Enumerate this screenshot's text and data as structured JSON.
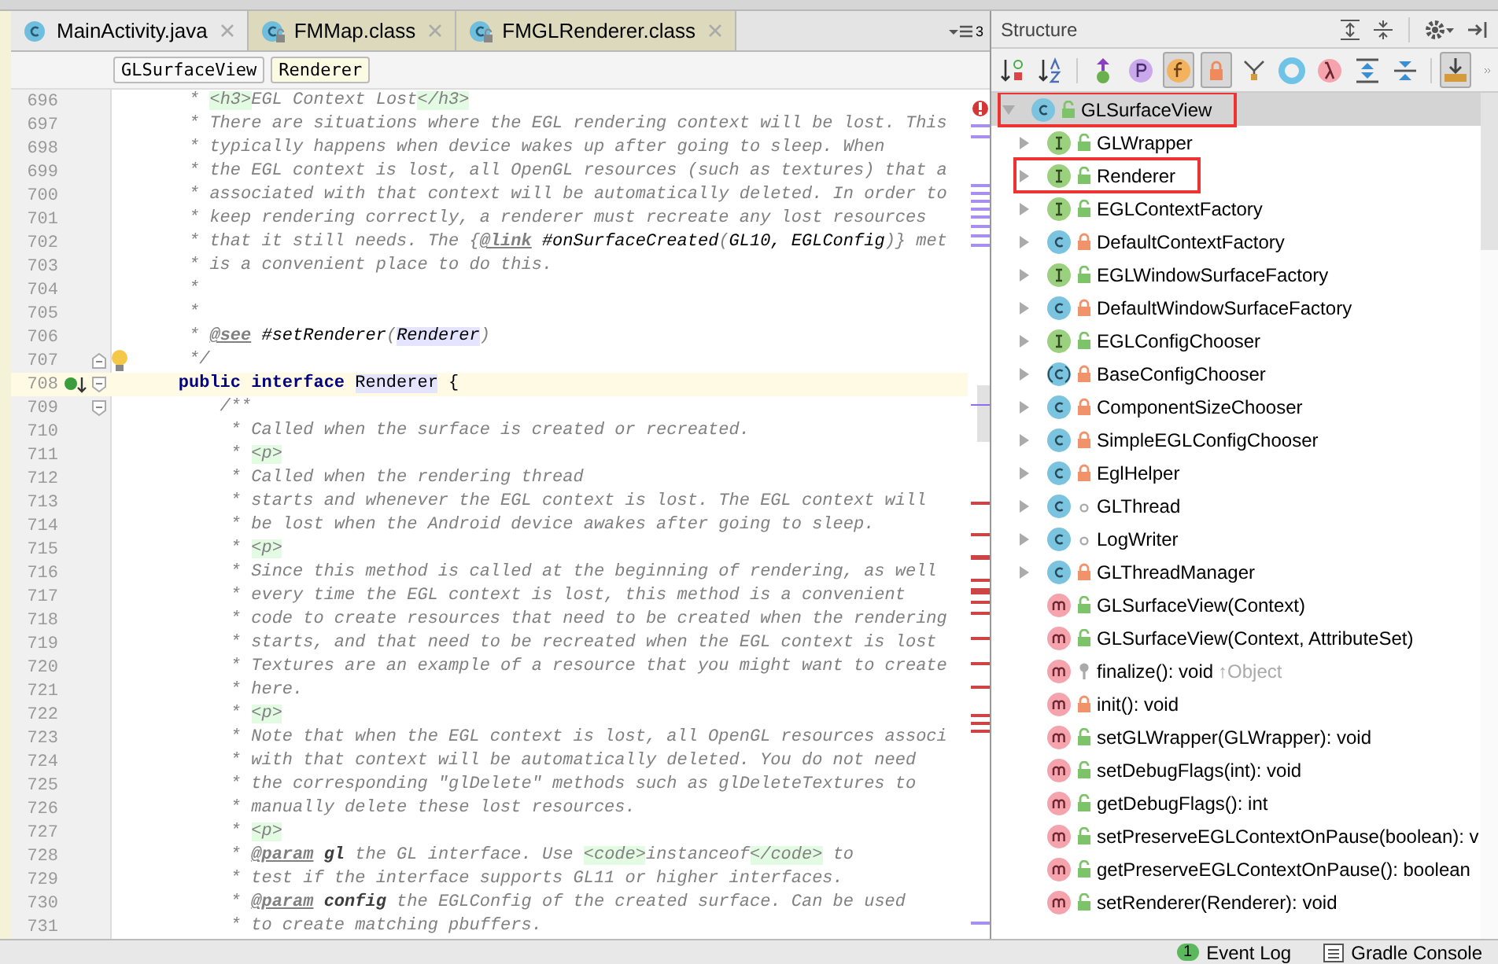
{
  "editor": {
    "tabs": [
      {
        "label": "MainActivity.java",
        "kind": "source"
      },
      {
        "label": "FMMap.class",
        "kind": "library"
      },
      {
        "label": "FMGLRenderer.class",
        "kind": "library"
      }
    ],
    "hidden_tabs_count": "3",
    "breadcrumbs": [
      {
        "label": "GLSurfaceView",
        "selected": false
      },
      {
        "label": "Renderer",
        "selected": true
      }
    ],
    "lines": [
      {
        "num": "696",
        "parts": [
          {
            "kind": "comment",
            "text": "     * "
          },
          {
            "kind": "tag",
            "text": "<h3>"
          },
          {
            "kind": "comment",
            "text": "EGL Context Lost"
          },
          {
            "kind": "tag",
            "text": "</h3>"
          }
        ]
      },
      {
        "num": "697",
        "parts": [
          {
            "kind": "comment",
            "text": "     * There are situations where the EGL rendering context will be lost. This"
          }
        ]
      },
      {
        "num": "698",
        "parts": [
          {
            "kind": "comment",
            "text": "     * typically happens when device wakes up after going to sleep. When"
          }
        ]
      },
      {
        "num": "699",
        "parts": [
          {
            "kind": "comment",
            "text": "     * the EGL context is lost, all OpenGL resources (such as textures) that a"
          }
        ]
      },
      {
        "num": "700",
        "parts": [
          {
            "kind": "comment",
            "text": "     * associated with that context will be automatically deleted. In order to"
          }
        ]
      },
      {
        "num": "701",
        "parts": [
          {
            "kind": "comment",
            "text": "     * keep rendering correctly, a renderer must recreate any lost resources"
          }
        ]
      },
      {
        "num": "702",
        "parts": [
          {
            "kind": "comment",
            "text": "     * that it still needs. The {"
          },
          {
            "kind": "doctag",
            "text": "@link"
          },
          {
            "kind": "ref",
            "text": " #onSurfaceCreated"
          },
          {
            "kind": "comment",
            "text": "("
          },
          {
            "kind": "ref",
            "text": "GL10, EGLConfig"
          },
          {
            "kind": "comment",
            "text": ")} met"
          }
        ]
      },
      {
        "num": "703",
        "parts": [
          {
            "kind": "comment",
            "text": "     * is a convenient place to do this."
          }
        ]
      },
      {
        "num": "704",
        "parts": [
          {
            "kind": "comment",
            "text": "     *"
          }
        ]
      },
      {
        "num": "705",
        "parts": [
          {
            "kind": "comment",
            "text": "     *"
          }
        ]
      },
      {
        "num": "706",
        "parts": [
          {
            "kind": "comment",
            "text": "     * "
          },
          {
            "kind": "doctag",
            "text": "@see"
          },
          {
            "kind": "ref",
            "text": " #setRenderer"
          },
          {
            "kind": "comment",
            "text": "("
          },
          {
            "kind": "usage",
            "text": "Renderer"
          },
          {
            "kind": "comment",
            "text": ")"
          }
        ]
      },
      {
        "num": "707",
        "fold_end": true,
        "bulb": true,
        "parts": [
          {
            "kind": "comment",
            "text": "     */"
          }
        ]
      },
      {
        "num": "708",
        "fold_start": true,
        "implemented": true,
        "current": true,
        "parts": [
          {
            "kind": "keyword",
            "text": "    public interface "
          },
          {
            "kind": "usage",
            "text": "Renderer"
          },
          {
            "kind": "code",
            "text": " {"
          }
        ]
      },
      {
        "num": "709",
        "fold_start": true,
        "parts": [
          {
            "kind": "comment",
            "text": "        /**"
          }
        ]
      },
      {
        "num": "710",
        "parts": [
          {
            "kind": "comment",
            "text": "         * Called when the surface is created or recreated."
          }
        ]
      },
      {
        "num": "711",
        "parts": [
          {
            "kind": "comment",
            "text": "         * "
          },
          {
            "kind": "tag",
            "text": "<p>"
          }
        ]
      },
      {
        "num": "712",
        "parts": [
          {
            "kind": "comment",
            "text": "         * Called when the rendering thread"
          }
        ]
      },
      {
        "num": "713",
        "parts": [
          {
            "kind": "comment",
            "text": "         * starts and whenever the EGL context is lost. The EGL context will"
          }
        ]
      },
      {
        "num": "714",
        "parts": [
          {
            "kind": "comment",
            "text": "         * be lost when the Android device awakes after going to sleep."
          }
        ]
      },
      {
        "num": "715",
        "parts": [
          {
            "kind": "comment",
            "text": "         * "
          },
          {
            "kind": "tag",
            "text": "<p>"
          }
        ]
      },
      {
        "num": "716",
        "parts": [
          {
            "kind": "comment",
            "text": "         * Since this method is called at the beginning of rendering, as well"
          }
        ]
      },
      {
        "num": "717",
        "parts": [
          {
            "kind": "comment",
            "text": "         * every time the EGL context is lost, this method is a convenient"
          }
        ]
      },
      {
        "num": "718",
        "parts": [
          {
            "kind": "comment",
            "text": "         * code to create resources that need to be created when the rendering"
          }
        ]
      },
      {
        "num": "719",
        "parts": [
          {
            "kind": "comment",
            "text": "         * starts, and that need to be recreated when the EGL context is lost"
          }
        ]
      },
      {
        "num": "720",
        "parts": [
          {
            "kind": "comment",
            "text": "         * Textures are an example of a resource that you might want to create"
          }
        ]
      },
      {
        "num": "721",
        "parts": [
          {
            "kind": "comment",
            "text": "         * here."
          }
        ]
      },
      {
        "num": "722",
        "parts": [
          {
            "kind": "comment",
            "text": "         * "
          },
          {
            "kind": "tag",
            "text": "<p>"
          }
        ]
      },
      {
        "num": "723",
        "parts": [
          {
            "kind": "comment",
            "text": "         * Note that when the EGL context is lost, all OpenGL resources associ"
          }
        ]
      },
      {
        "num": "724",
        "parts": [
          {
            "kind": "comment",
            "text": "         * with that context will be automatically deleted. You do not need"
          }
        ]
      },
      {
        "num": "725",
        "parts": [
          {
            "kind": "comment",
            "text": "         * the corresponding \"glDelete\" methods such as glDeleteTextures to"
          }
        ]
      },
      {
        "num": "726",
        "parts": [
          {
            "kind": "comment",
            "text": "         * manually delete these lost resources."
          }
        ]
      },
      {
        "num": "727",
        "parts": [
          {
            "kind": "comment",
            "text": "         * "
          },
          {
            "kind": "tag",
            "text": "<p>"
          }
        ]
      },
      {
        "num": "728",
        "parts": [
          {
            "kind": "comment",
            "text": "         * "
          },
          {
            "kind": "doctag",
            "text": "@param"
          },
          {
            "kind": "param",
            "text": " gl"
          },
          {
            "kind": "comment",
            "text": " the GL interface. Use "
          },
          {
            "kind": "tag",
            "text": "<code>"
          },
          {
            "kind": "comment",
            "text": "instanceof"
          },
          {
            "kind": "tag",
            "text": "</code>"
          },
          {
            "kind": "comment",
            "text": " to"
          }
        ]
      },
      {
        "num": "729",
        "parts": [
          {
            "kind": "comment",
            "text": "         * test if the interface supports GL11 or higher interfaces."
          }
        ]
      },
      {
        "num": "730",
        "parts": [
          {
            "kind": "comment",
            "text": "         * "
          },
          {
            "kind": "doctag",
            "text": "@param"
          },
          {
            "kind": "param",
            "text": " config"
          },
          {
            "kind": "comment",
            "text": " the EGLConfig of the created surface. Can be used"
          }
        ]
      },
      {
        "num": "731",
        "parts": [
          {
            "kind": "comment",
            "text": "         * to create matching pbuffers."
          }
        ]
      }
    ]
  },
  "structure": {
    "title": "Structure",
    "toolbar": [
      {
        "kind": "sort-visibility",
        "on": false
      },
      {
        "kind": "sort-alpha",
        "on": false
      },
      {
        "kind": "inherited",
        "on": false
      },
      {
        "kind": "properties",
        "on": false
      },
      {
        "kind": "fields",
        "on": true
      },
      {
        "kind": "non-public",
        "on": true
      },
      {
        "kind": "anonymous",
        "on": false
      },
      {
        "kind": "circle",
        "on": false
      },
      {
        "kind": "lambda",
        "on": false
      },
      {
        "kind": "expand",
        "on": false
      },
      {
        "kind": "collapse",
        "on": false
      },
      {
        "kind": "autoscroll",
        "on": true
      }
    ],
    "tree": {
      "name": "GLSurfaceView",
      "kind": "class",
      "private": false,
      "protected": false,
      "package": false,
      "expanded": true,
      "selected": true,
      "highlighted": true,
      "children": [
        {
          "name": "GLWrapper",
          "kind": "interface",
          "private": false,
          "protected": false,
          "package": false,
          "expandable": true,
          "highlighted": false
        },
        {
          "name": "Renderer",
          "kind": "interface",
          "private": false,
          "protected": false,
          "package": false,
          "expandable": true,
          "highlighted": true
        },
        {
          "name": "EGLContextFactory",
          "kind": "interface",
          "private": false,
          "protected": false,
          "package": false,
          "expandable": true,
          "highlighted": false
        },
        {
          "name": "DefaultContextFactory",
          "kind": "class",
          "private": true,
          "protected": false,
          "package": false,
          "expandable": true,
          "highlighted": false
        },
        {
          "name": "EGLWindowSurfaceFactory",
          "kind": "interface",
          "private": false,
          "protected": false,
          "package": false,
          "expandable": true,
          "highlighted": false
        },
        {
          "name": "DefaultWindowSurfaceFactory",
          "kind": "class",
          "private": true,
          "protected": false,
          "package": false,
          "expandable": true,
          "highlighted": false
        },
        {
          "name": "EGLConfigChooser",
          "kind": "interface",
          "private": false,
          "protected": false,
          "package": false,
          "expandable": true,
          "highlighted": false
        },
        {
          "name": "BaseConfigChooser",
          "kind": "abstract",
          "private": true,
          "protected": false,
          "package": false,
          "expandable": true,
          "highlighted": false
        },
        {
          "name": "ComponentSizeChooser",
          "kind": "class",
          "private": true,
          "protected": false,
          "package": false,
          "expandable": true,
          "highlighted": false
        },
        {
          "name": "SimpleEGLConfigChooser",
          "kind": "class",
          "private": true,
          "protected": false,
          "package": false,
          "expandable": true,
          "highlighted": false
        },
        {
          "name": "EglHelper",
          "kind": "class",
          "private": true,
          "protected": false,
          "package": false,
          "expandable": true,
          "highlighted": false
        },
        {
          "name": "GLThread",
          "kind": "class",
          "private": false,
          "protected": false,
          "package": true,
          "expandable": true,
          "highlighted": false
        },
        {
          "name": "LogWriter",
          "kind": "class",
          "private": false,
          "protected": false,
          "package": true,
          "expandable": true,
          "highlighted": false
        },
        {
          "name": "GLThreadManager",
          "kind": "class",
          "private": true,
          "protected": false,
          "package": false,
          "expandable": true,
          "highlighted": false
        },
        {
          "name": "GLSurfaceView(Context)",
          "kind": "method",
          "private": false,
          "protected": false,
          "package": false,
          "expandable": false,
          "highlighted": false
        },
        {
          "name": "GLSurfaceView(Context, AttributeSet)",
          "kind": "method",
          "private": false,
          "protected": false,
          "package": false,
          "expandable": false,
          "highlighted": false
        },
        {
          "name": "finalize(): void",
          "kind": "method",
          "private": false,
          "protected": true,
          "package": false,
          "expandable": false,
          "highlighted": false,
          "inherited": "↑Object"
        },
        {
          "name": "init(): void",
          "kind": "method",
          "private": true,
          "protected": false,
          "package": false,
          "expandable": false,
          "highlighted": false
        },
        {
          "name": "setGLWrapper(GLWrapper): void",
          "kind": "method",
          "private": false,
          "protected": false,
          "package": false,
          "expandable": false,
          "highlighted": false
        },
        {
          "name": "setDebugFlags(int): void",
          "kind": "method",
          "private": false,
          "protected": false,
          "package": false,
          "expandable": false,
          "highlighted": false
        },
        {
          "name": "getDebugFlags(): int",
          "kind": "method",
          "private": false,
          "protected": false,
          "package": false,
          "expandable": false,
          "highlighted": false
        },
        {
          "name": "setPreserveEGLContextOnPause(boolean): v",
          "kind": "method",
          "private": false,
          "protected": false,
          "package": false,
          "expandable": false,
          "highlighted": false
        },
        {
          "name": "getPreserveEGLContextOnPause(): boolean",
          "kind": "method",
          "private": false,
          "protected": false,
          "package": false,
          "expandable": false,
          "highlighted": false
        },
        {
          "name": "setRenderer(Renderer): void",
          "kind": "method",
          "private": false,
          "protected": false,
          "package": false,
          "expandable": false,
          "highlighted": false
        }
      ]
    }
  },
  "status_bar": {
    "event_log": {
      "label": "Event Log",
      "count": "1"
    },
    "gradle_console": {
      "label": "Gradle Console"
    }
  }
}
